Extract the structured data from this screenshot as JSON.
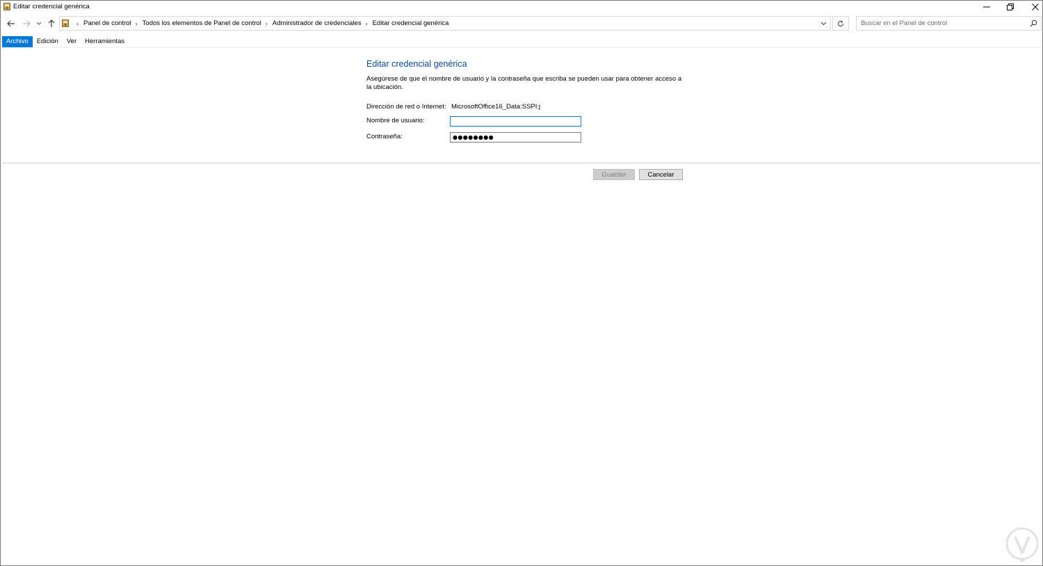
{
  "window": {
    "title": "Editar credencial genérica"
  },
  "address_bar": {
    "crumbs": [
      "Panel de control",
      "Todos los elementos de Panel de control",
      "Administrador de credenciales",
      "Editar credencial genérica"
    ]
  },
  "search": {
    "placeholder": "Buscar en el Panel de control"
  },
  "menu": {
    "items": [
      "Archivo",
      "Edición",
      "Ver",
      "Herramientas"
    ],
    "active": "Archivo"
  },
  "form": {
    "title": "Editar credencial genérica",
    "description": "Asegúrese de que el nombre de usuario y la contraseña que escriba se pueden usar para obtener acceso a la ubicación.",
    "address_label": "Dirección de red o Internet:",
    "address_value": "MicrosoftOffice16_Data:SSPI:j",
    "username_label": "Nombre de usuario:",
    "username_value": "",
    "password_label": "Contraseña:",
    "password_mask": "●●●●●●●●"
  },
  "buttons": {
    "save": "Guardar",
    "cancel": "Cancelar"
  },
  "colors": {
    "accent": "#0078d7",
    "title_blue": "#0b4a8f"
  }
}
